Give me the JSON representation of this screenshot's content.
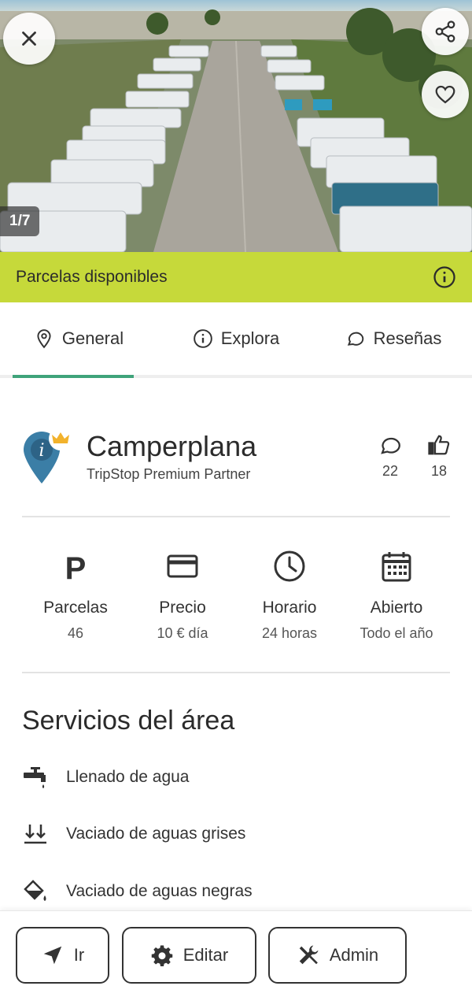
{
  "colors": {
    "availability_bar": "#c6d93a",
    "tab_indicator": "#3fa37a",
    "pin": "#3b7ea6",
    "crown": "#f2b22c"
  },
  "gallery": {
    "counter": "1/7"
  },
  "availability": {
    "label": "Parcelas disponibles"
  },
  "tabs": [
    {
      "label": "General",
      "icon": "location-pin-icon",
      "active": true
    },
    {
      "label": "Explora",
      "icon": "info-icon",
      "active": false
    },
    {
      "label": "Reseñas",
      "icon": "chat-bubble-icon",
      "active": false
    }
  ],
  "place": {
    "name": "Camperplana",
    "subtitle": "TripStop Premium Partner",
    "comments": "22",
    "likes": "18"
  },
  "info": [
    {
      "icon": "parking-icon",
      "label": "Parcelas",
      "value": "46"
    },
    {
      "icon": "credit-card-icon",
      "label": "Precio",
      "value": "10 € día"
    },
    {
      "icon": "clock-icon",
      "label": "Horario",
      "value": "24 horas"
    },
    {
      "icon": "calendar-icon",
      "label": "Abierto",
      "value": "Todo el año"
    }
  ],
  "services": {
    "title": "Servicios del área",
    "items": [
      {
        "icon": "water-tap-icon",
        "label": "Llenado de agua"
      },
      {
        "icon": "double-arrow-down-icon",
        "label": "Vaciado de aguas grises"
      },
      {
        "icon": "bucket-icon",
        "label": "Vaciado de aguas negras"
      }
    ]
  },
  "actions": {
    "go": "Ir",
    "edit": "Editar",
    "admin": "Admin"
  }
}
